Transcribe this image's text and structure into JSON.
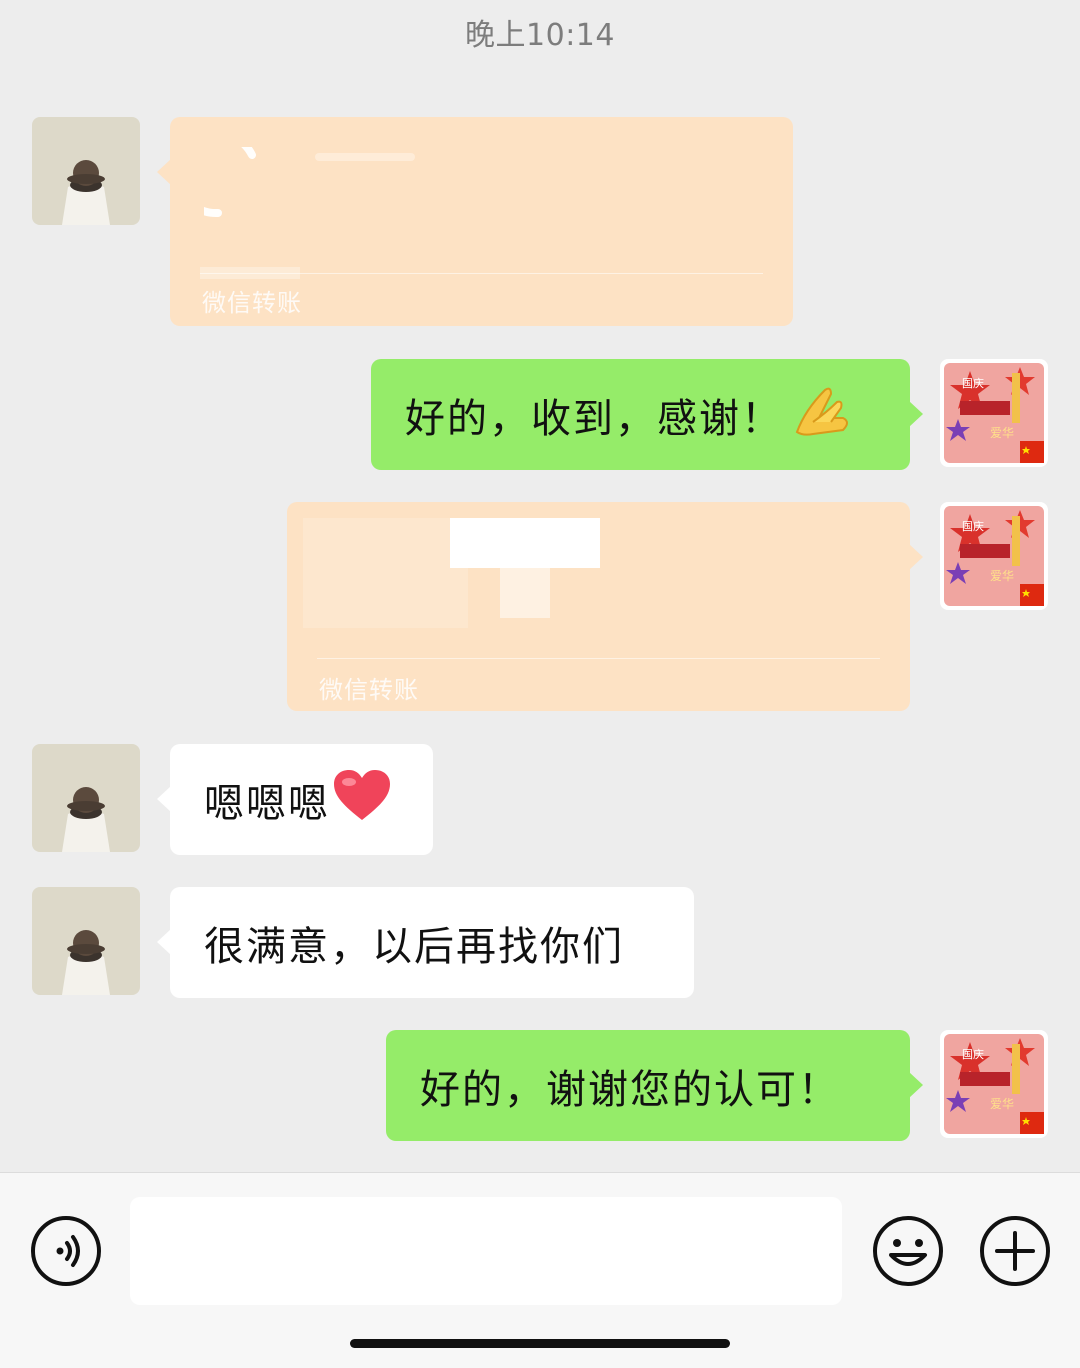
{
  "timestamp": "晚上10:14",
  "messages": {
    "transfer1": {
      "label": "微信转账"
    },
    "msg_ok_received": {
      "text": "好的，收到，感谢！",
      "emoji": "praying-hands-icon"
    },
    "transfer2": {
      "label": "微信转账"
    },
    "msg_enen": {
      "text": "嗯嗯嗯",
      "emoji": "red-heart-icon"
    },
    "msg_satisfied": {
      "text": "很满意，以后再找你们"
    },
    "msg_thanks": {
      "text": "好的，谢谢您的认可！"
    }
  },
  "colors": {
    "chat_bg": "#ededed",
    "self_bubble": "#95ec69",
    "other_bubble": "#ffffff",
    "transfer_bubble": "#fde2c4",
    "inputbar_bg": "#f7f7f7"
  },
  "inputbar": {
    "voice_icon": "voice-icon",
    "emoji_icon": "emoji-smile-icon",
    "more_icon": "plus-icon"
  }
}
